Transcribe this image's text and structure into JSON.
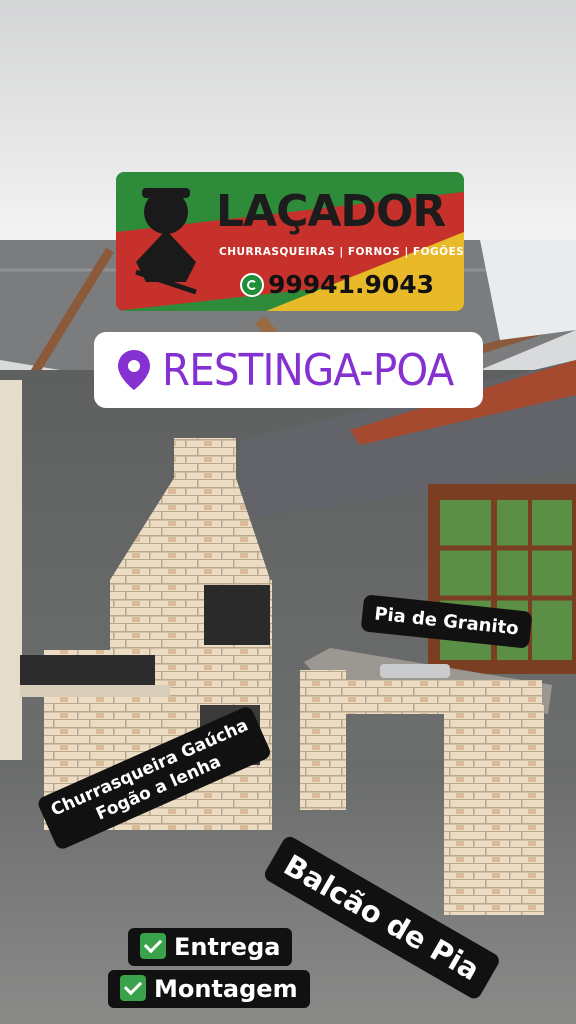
{
  "banner": {
    "title": "LAÇADOR",
    "subtitle": "CHURRASQUEIRAS | FORNOS | FOGÕES",
    "phone": "99941.9043",
    "phone_icon": "whatsapp-icon",
    "colors": {
      "green": "#2e8b3a",
      "red": "#c6322b",
      "yellow": "#e8b928"
    }
  },
  "location": {
    "label": "RESTINGA-POA",
    "icon": "location-pin-icon",
    "color": "#8530d1"
  },
  "captions": {
    "sink": "Pia de Granito",
    "grill_line1": "Churrasqueira Gaúcha",
    "grill_line2": "Fogão a lenha",
    "counter": "Balcão de Pia"
  },
  "features": [
    {
      "label": "Entrega",
      "icon": "check-icon"
    },
    {
      "label": "Montagem",
      "icon": "check-icon"
    }
  ]
}
